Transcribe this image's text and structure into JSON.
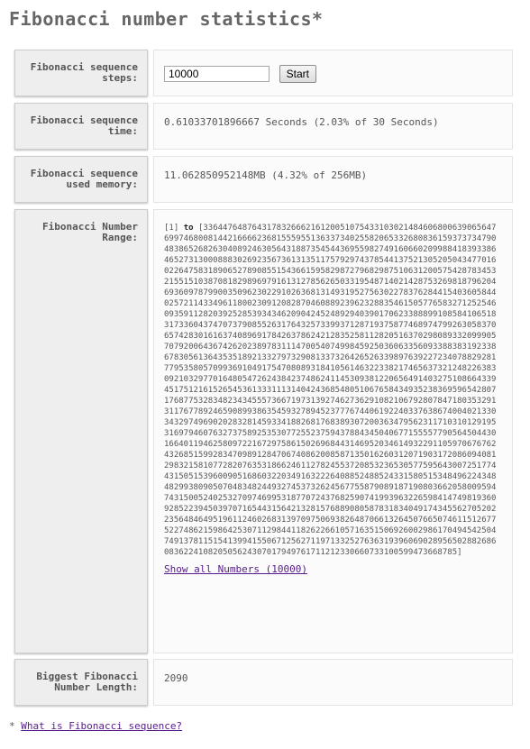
{
  "page_title": "Fibonacci number statistics*",
  "rows": {
    "steps": {
      "label": "Fibonacci sequence steps:",
      "input_value": "10000",
      "button": "Start"
    },
    "time": {
      "label": "Fibonacci sequence time:",
      "value": "0.61033701896667 Seconds (2.03% of 30 Seconds)"
    },
    "memory": {
      "label": "Fibonacci sequence used memory:",
      "value": "11.062850952148MB (4.32% of 256MB)"
    },
    "range": {
      "label": "Fibonacci Number Range:",
      "prefix": "[1] ",
      "to": "to",
      "number": " [3364476487643178326662161200510754331030214846068006390656476997468008144216666236815559551363373402558206533268083615937373479048386526826304089246305643188735454436955982749160660209988418393386465273130008883026923567361313511757929743785441375213052050434770160226475831890652789085515436615958298727968298751063120057542878345321551510387081829896979161312785626503319548714021428753269818796204693609787990035096230229102636813149319527563022783762844154036058440257211433496118002309120828704608892396232883546150577658327125254609359112820392528539343462090424524892940390170623388899108584106518317336043747073790855263176432573399371287193758774689747992630583706574283016163740896917842637862421283525811282051637029808933209990570792006436742620238978311147005407499845925036063356093388383192338678305613643535189213327973290813373264265263398976392272340788292817795358057099369104917547080893184105614632233821746563732124822638309210329770164805472624384237486241145309381220656491403275108664339451751216152654536133311131404243685480510676584349352383695965428071768775328348234345557366719731392746273629108210679280784718035329131176778924659089938635459327894523777674406192240337638674004021330343297496902028328145933418826817683893072003634795623117103101291953169794607632737589253530772552375943788434504067715555779056450443016640119462580972216729758615026968443146952034614932291105970676762432685159928347098912847067408620085871350162603120719031720860940812983215810772820763531866246112782455372085323653057759564300725177443150515396009051686032203491632226408852488524331580515348496224348482993809050704834824493274537326245677558790891871908036620580095947431500524025327097469953187707243768259074199396322659841474981936092852239450397071654431564213281576889080587831834049174345562705202235648464951961124602683139709750693826487066132645076650746115126775227486215986425307112984411826226610571635150692600298617049454250474913781151541399415506712562711971332527636319396069028956502882686083622410820505624307017949761711212330660733100599473668785]"
    },
    "length": {
      "label": "Biggest Fibonacci Number Length:",
      "value": "2090"
    }
  },
  "show_all_link": "Show all Numbers (10000)",
  "footer": {
    "asterisk": "* ",
    "link": "What is Fibonacci sequence?"
  }
}
